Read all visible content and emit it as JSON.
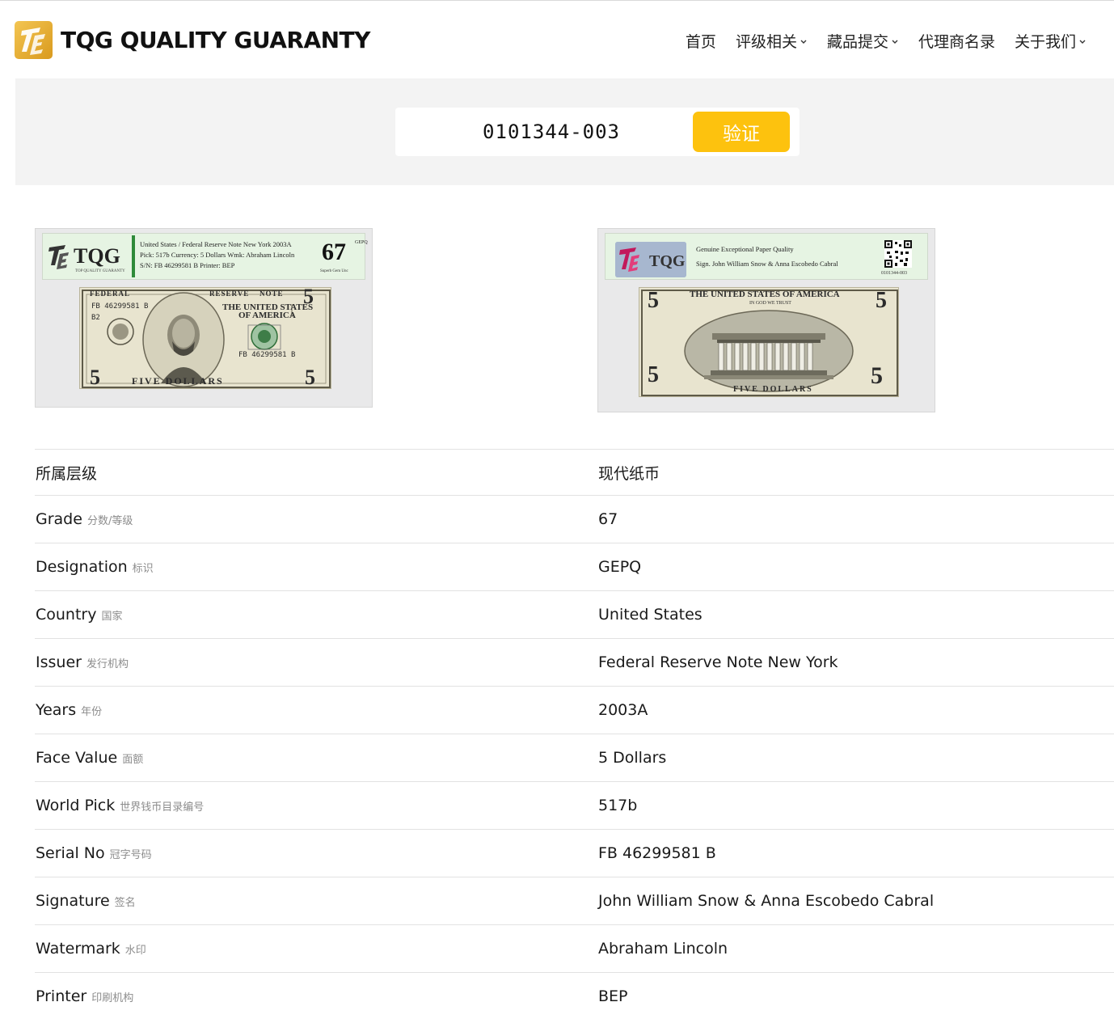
{
  "brand": {
    "name": "TQG QUALITY GUARANTY"
  },
  "nav": [
    {
      "label": "首页",
      "dropdown": false
    },
    {
      "label": "评级相关",
      "dropdown": true
    },
    {
      "label": "藏品提交",
      "dropdown": true
    },
    {
      "label": "代理商名录",
      "dropdown": false
    },
    {
      "label": "关于我们",
      "dropdown": true
    }
  ],
  "search": {
    "value": "0101344-003",
    "button_label": "验证"
  },
  "front_label": {
    "line1": "United States / Federal Reserve Note New York   2003A",
    "line2": "Pick: 517b    Currency: 5 Dollars    Wmk: Abraham Lincoln",
    "line3": "S/N: FB 46299581 B    Printer: BEP",
    "grade": "67",
    "designation": "GEPQ",
    "grade_desc": "Superb Gem Unc",
    "caption": "TOP QUALITY GUARANTY"
  },
  "front_note": {
    "federal": "FEDERAL",
    "reserve": "RESERVE",
    "note": "NOTE",
    "serial": "FB 46299581 B",
    "district": "B2",
    "title": "THE UNITED STATES",
    "title2": "OF AMERICA",
    "denom": "5",
    "bottom": "FIVE      DOLLARS"
  },
  "back_label": {
    "line1": "Genuine Exceptional Paper Quality",
    "line2": "Sign. John William Snow & Anna Escobedo Cabral",
    "cert": "0101344-003"
  },
  "back_note": {
    "title": "THE UNITED STATES OF AMERICA",
    "motto": "IN GOD WE TRUST",
    "bottom": "FIVE DOLLARS",
    "denom": "5"
  },
  "details": {
    "category": {
      "label": "所属层级",
      "value": "现代纸币"
    },
    "rows": [
      {
        "label": "Grade",
        "label_cn": "分数/等级",
        "value": "67"
      },
      {
        "label": "Designation",
        "label_cn": "标识",
        "value": "GEPQ"
      },
      {
        "label": "Country",
        "label_cn": "国家",
        "value": "United States"
      },
      {
        "label": "Issuer",
        "label_cn": "发行机构",
        "value": "Federal Reserve Note New York"
      },
      {
        "label": "Years",
        "label_cn": "年份",
        "value": "2003A"
      },
      {
        "label": "Face Value",
        "label_cn": "面额",
        "value": "5 Dollars"
      },
      {
        "label": "World Pick",
        "label_cn": "世界钱币目录编号",
        "value": "517b"
      },
      {
        "label": "Serial No",
        "label_cn": "冠字号码",
        "value": "FB 46299581 B"
      },
      {
        "label": "Signature",
        "label_cn": "签名",
        "value": "John William Snow & Anna Escobedo Cabral"
      },
      {
        "label": "Watermark",
        "label_cn": "水印",
        "value": "Abraham Lincoln"
      },
      {
        "label": "Printer",
        "label_cn": "印刷机构",
        "value": "BEP"
      }
    ]
  },
  "colors": {
    "accent": "#fdc20e",
    "label_green": "#2f8a3a",
    "band_bg": "#f3f3f3"
  }
}
